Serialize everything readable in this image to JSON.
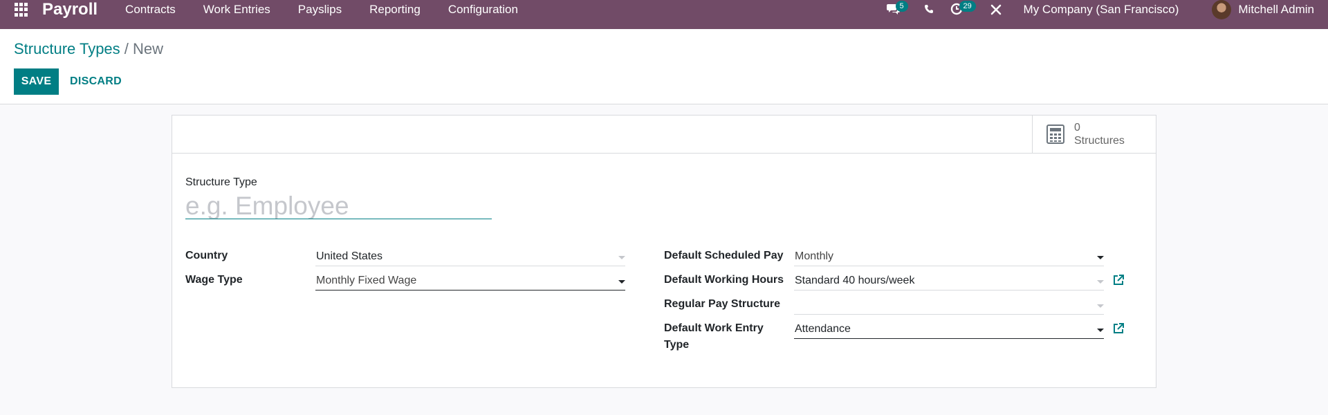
{
  "app": {
    "name": "Payroll",
    "menu": [
      "Contracts",
      "Work Entries",
      "Payslips",
      "Reporting",
      "Configuration"
    ]
  },
  "systray": {
    "messages_badge": "5",
    "activities_badge": "29",
    "company": "My Company (San Francisco)",
    "user": "Mitchell Admin"
  },
  "breadcrumb": {
    "parent": "Structure Types",
    "separator": "/",
    "current": "New"
  },
  "buttons": {
    "save": "SAVE",
    "discard": "DISCARD"
  },
  "stat_button": {
    "count": "0",
    "label": "Structures",
    "icon": "calculator-icon"
  },
  "form": {
    "title_label": "Structure Type",
    "title_placeholder": "e.g. Employee",
    "left": {
      "country_label": "Country",
      "country_value": "United States",
      "wage_type_label": "Wage Type",
      "wage_type_value": "Monthly Fixed Wage"
    },
    "right": {
      "scheduled_pay_label": "Default Scheduled Pay",
      "scheduled_pay_value": "Monthly",
      "working_hours_label": "Default Working Hours",
      "working_hours_value": "Standard 40 hours/week",
      "regular_pay_structure_label": "Regular Pay Structure",
      "regular_pay_structure_value": "",
      "work_entry_type_label_line1": "Default Work Entry",
      "work_entry_type_label_line2": "Type",
      "work_entry_type_value": "Attendance"
    }
  },
  "colors": {
    "navbar": "#714b67",
    "primary": "#017e84",
    "badge": "#017e84"
  }
}
